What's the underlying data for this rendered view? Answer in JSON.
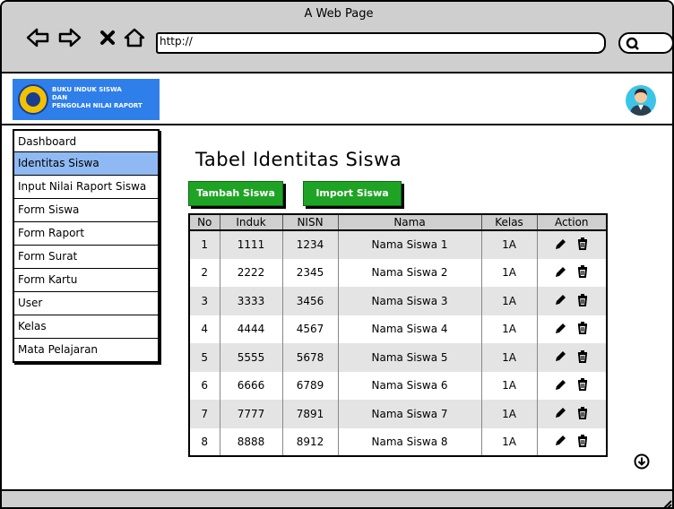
{
  "window": {
    "title": "A Web Page"
  },
  "browser": {
    "url": "http://",
    "icons": [
      "back-arrow-icon",
      "forward-arrow-icon",
      "close-icon",
      "home-icon",
      "search-icon"
    ]
  },
  "header": {
    "logo_lines": [
      "BUKU INDUK SISWA",
      "DAN",
      "PENGOLAH NILAI RAPORT"
    ],
    "logo_colors": {
      "background": "#2f7fea",
      "seal": "#f2c200"
    },
    "avatar_color": "#3cc4e8"
  },
  "sidebar": {
    "items": [
      {
        "label": "Dashboard",
        "active": false
      },
      {
        "label": "Identitas Siswa",
        "active": true
      },
      {
        "label": "Input Nilai Raport Siswa",
        "active": false
      },
      {
        "label": "Form Siswa",
        "active": false
      },
      {
        "label": "Form Raport",
        "active": false
      },
      {
        "label": "Form Surat",
        "active": false
      },
      {
        "label": "Form Kartu",
        "active": false
      },
      {
        "label": "User",
        "active": false
      },
      {
        "label": "Kelas",
        "active": false
      },
      {
        "label": "Mata Pelajaran",
        "active": false
      }
    ],
    "active_color": "#8fb9f2"
  },
  "main": {
    "title": "Tabel Identitas Siswa",
    "buttons": {
      "add_label": "Tambah Siswa",
      "import_label": "Import Siswa",
      "color": "#1fa324"
    },
    "table": {
      "columns": [
        "No",
        "Induk",
        "NISN",
        "Nama",
        "Kelas",
        "Action"
      ],
      "rows": [
        {
          "no": "1",
          "induk": "1111",
          "nisn": "1234",
          "nama": "Nama Siswa 1",
          "kelas": "1A"
        },
        {
          "no": "2",
          "induk": "2222",
          "nisn": "2345",
          "nama": "Nama Siswa 2",
          "kelas": "1A"
        },
        {
          "no": "3",
          "induk": "3333",
          "nisn": "3456",
          "nama": "Nama Siswa 3",
          "kelas": "1A"
        },
        {
          "no": "4",
          "induk": "4444",
          "nisn": "4567",
          "nama": "Nama Siswa 4",
          "kelas": "1A"
        },
        {
          "no": "5",
          "induk": "5555",
          "nisn": "5678",
          "nama": "Nama Siswa 5",
          "kelas": "1A"
        },
        {
          "no": "6",
          "induk": "6666",
          "nisn": "6789",
          "nama": "Nama Siswa 6",
          "kelas": "1A"
        },
        {
          "no": "7",
          "induk": "7777",
          "nisn": "7891",
          "nama": "Nama Siswa 7",
          "kelas": "1A"
        },
        {
          "no": "8",
          "induk": "8888",
          "nisn": "8912",
          "nama": "Nama Siswa 8",
          "kelas": "1A"
        }
      ],
      "row_actions": [
        "pencil-edit-icon",
        "trash-delete-icon"
      ]
    }
  }
}
